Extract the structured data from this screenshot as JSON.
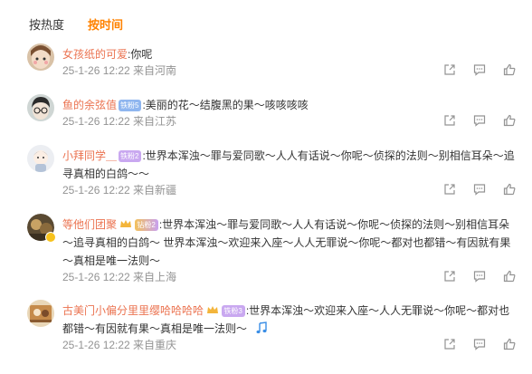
{
  "sort": {
    "hot": "按热度",
    "time": "按时间"
  },
  "comments": [
    {
      "username": "女孩纸的可爱",
      "badge": "",
      "text": ":你呢",
      "meta": "25-1-26 12:22 来自河南"
    },
    {
      "username": "鱼的余弦值",
      "badge": "铁粉5",
      "text": ":美丽的花～结腹黑的果～咳咳咳咳",
      "meta": "25-1-26 12:22 来自江苏"
    },
    {
      "username": "小拜同学＿",
      "badge": "铁粉2",
      "text": ":世界本浑浊～罪与爱同歌～人人有话说～你呢～侦探的法则～别相信耳朵～追寻真相的白鸽～～",
      "meta": "25-1-26 12:22 来自新疆"
    },
    {
      "username": "等他们团聚",
      "badge": "钻粉2",
      "text": ":世界本浑浊～罪与爱同歌～人人有话说～你呢～侦探的法则～别相信耳朵～追寻真相的白鸽～ 世界本浑浊～欢迎来入座～人人无罪说～你呢～都对也都错～有因就有果～真相是唯一法则～",
      "meta": "25-1-26 12:22 来自上海"
    },
    {
      "username": "古美门小偏分里里缨哈哈哈哈",
      "badge": "铁粉3",
      "text": ":世界本浑浊～欢迎来入座～人人无罪说～你呢～都对也都错～有因就有果～真相是唯一法则～",
      "meta": "25-1-26 12:22 来自重庆"
    }
  ],
  "icons": {
    "share": "share-icon",
    "comment": "comment-icon",
    "like": "like-icon",
    "music": "music-note-icon"
  },
  "colors": {
    "accent": "#ff8200",
    "username": "#eb7350",
    "meta": "#939393"
  }
}
